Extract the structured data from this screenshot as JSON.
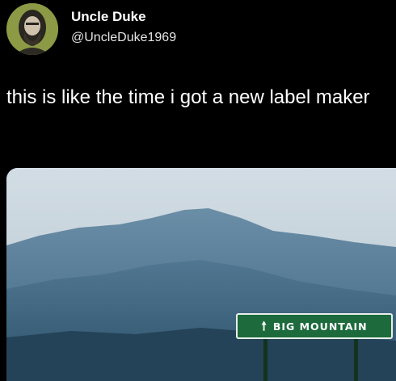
{
  "author": {
    "display_name": "Uncle Duke",
    "handle": "@UncleDuke1969",
    "avatar_icon": "profile-photo"
  },
  "tweet": {
    "text": "this is like the time i got a new label maker"
  },
  "media": {
    "sign": {
      "arrow_icon": "up-arrow",
      "text": "BIG MOUNTAIN",
      "color": "#1d6b3c"
    },
    "colors": {
      "sky": "#c9d5de",
      "mountain": "#5f86a0",
      "foreground": "#2e5570"
    }
  }
}
